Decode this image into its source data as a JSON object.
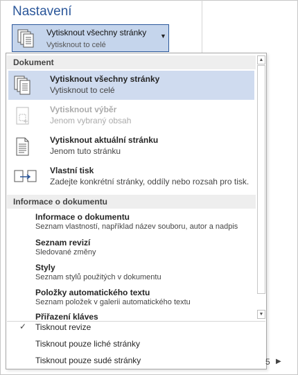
{
  "section_title": "Nastavení",
  "combo": {
    "title": "Vytisknout všechny stránky",
    "subtitle": "Vytisknout to celé",
    "arrow_icon": "chevron-down-icon"
  },
  "menu": {
    "section1": "Dokument",
    "items": [
      {
        "title": "Vytisknout všechny stránky",
        "desc": "Vytisknout to celé",
        "icon": "pages-icon",
        "state": "selected"
      },
      {
        "title": "Vytisknout výběr",
        "desc": "Jenom vybraný obsah",
        "icon": "selection-icon",
        "state": "disabled"
      },
      {
        "title": "Vytisknout aktuální stránku",
        "desc": "Jenom tuto stránku",
        "icon": "page-icon",
        "state": "normal"
      },
      {
        "title": "Vlastní tisk",
        "desc": "Zadejte konkrétní stránky, oddíly nebo rozsah pro tisk.",
        "icon": "custom-range-icon",
        "state": "normal"
      }
    ],
    "section2": "Informace o dokumentu",
    "properties": [
      {
        "title": "Informace o dokumentu",
        "desc": "Seznam vlastností, například název souboru, autor a nadpis"
      },
      {
        "title": "Seznam revizí",
        "desc": "Sledované změny"
      },
      {
        "title": "Styly",
        "desc": "Seznam stylů použitých v dokumentu"
      },
      {
        "title": "Položky automatického textu",
        "desc": "Seznam položek v galerii automatického textu"
      },
      {
        "title": "Přiřazení kláves",
        "desc": ""
      }
    ],
    "options": [
      {
        "label": "Tisknout revize",
        "checked": true
      },
      {
        "label": "Tisknout pouze liché stránky",
        "checked": false
      },
      {
        "label": "Tisknout pouze sudé stránky",
        "checked": false
      }
    ],
    "check_glyph": "✓"
  },
  "page_indicator": "5",
  "next_arrow": "▶",
  "scroll": {
    "up": "▲",
    "down": "▼"
  },
  "accent_color": "#2b579a",
  "selected_bg": "#cfdbef"
}
